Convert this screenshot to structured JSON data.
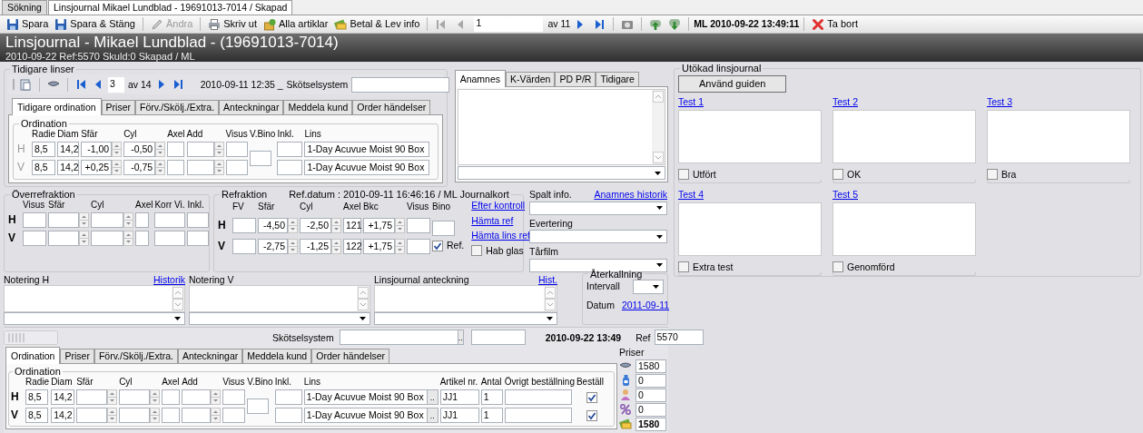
{
  "doc_tabs": [
    {
      "label": "Sökning",
      "selected": false
    },
    {
      "label": "Linsjournal Mikael Lundblad - 19691013-7014 / Skapad",
      "selected": true
    }
  ],
  "toolbar": [
    {
      "kind": "button",
      "label": "Spara",
      "disabled": false
    },
    {
      "kind": "button",
      "label": "Spara & Stäng",
      "disabled": false
    },
    {
      "kind": "separator"
    },
    {
      "kind": "button",
      "label": "Ändra",
      "disabled": true
    },
    {
      "kind": "separator"
    },
    {
      "kind": "button",
      "label": "Skriv ut",
      "disabled": false
    },
    {
      "kind": "button",
      "label": "Alla artiklar",
      "disabled": false
    },
    {
      "kind": "button",
      "label": "Betal & Lev info",
      "disabled": false
    },
    {
      "kind": "separator"
    },
    {
      "kind": "first",
      "disabled": true
    },
    {
      "kind": "prev",
      "disabled": true
    },
    {
      "kind": "page",
      "value": "1"
    },
    {
      "kind": "text",
      "label": "av 11"
    },
    {
      "kind": "next",
      "disabled": false
    },
    {
      "kind": "last",
      "disabled": false
    },
    {
      "kind": "separator"
    },
    {
      "kind": "icon",
      "disabled": false
    },
    {
      "kind": "separator"
    },
    {
      "kind": "icon",
      "disabled": false
    },
    {
      "kind": "icon",
      "disabled": false
    },
    {
      "kind": "separator"
    },
    {
      "kind": "status",
      "label": "ML 2010-09-22 13:49:11"
    },
    {
      "kind": "separator"
    },
    {
      "kind": "button",
      "label": "Ta bort",
      "disabled": false
    }
  ],
  "header": {
    "title": "Linsjournal - Mikael Lundblad - (19691013-7014)",
    "subtitle": "2010-09-22 Ref:5570 Skuld:0 Skapad / ML"
  },
  "previous_lenses": {
    "title": "Tidigare linser",
    "page": "3",
    "page_total": "av 14",
    "date": "2010-09-11 12:35 _",
    "care_system_label": "Skötselsystem",
    "tabs": [
      {
        "label": "Tidigare ordination",
        "selected": true
      },
      {
        "label": "Priser",
        "selected": false
      },
      {
        "label": "Förv./Skölj./Extra.",
        "selected": false
      },
      {
        "label": "Anteckningar",
        "selected": false
      },
      {
        "label": "Meddela kund",
        "selected": false
      },
      {
        "label": "Order händelser",
        "selected": false
      }
    ],
    "ordination": {
      "title": "Ordination",
      "readonly": true,
      "columns": [
        "Radie",
        "Diam",
        "Sfär",
        "Cyl",
        "Axel",
        "Add",
        "Visus",
        "V.Bino",
        "Inkl.",
        "Lins"
      ],
      "rows": [
        {
          "eye": "H",
          "cells": [
            {
              "kind": "text",
              "value": "8,5"
            },
            {
              "kind": "text",
              "value": "14,2"
            },
            {
              "kind": "spin",
              "value": "-1,00"
            },
            {
              "kind": "spin",
              "value": "-0,50"
            },
            {
              "kind": "text"
            },
            {
              "kind": "spin"
            },
            {
              "kind": "text"
            },
            {
              "kind": "shared"
            },
            {
              "kind": "text"
            },
            {
              "kind": "text",
              "value": "1-Day Acuvue Moist 90 Box"
            }
          ]
        },
        {
          "eye": "V",
          "cells": [
            {
              "kind": "text",
              "value": "8,5"
            },
            {
              "kind": "text",
              "value": "14,2"
            },
            {
              "kind": "spin",
              "value": "+0,25"
            },
            {
              "kind": "spin",
              "value": "-0,75"
            },
            {
              "kind": "text"
            },
            {
              "kind": "spin"
            },
            {
              "kind": "text"
            },
            {
              "kind": "shared"
            },
            {
              "kind": "text"
            },
            {
              "kind": "text",
              "value": "1-Day Acuvue Moist 90 Box"
            }
          ]
        }
      ]
    }
  },
  "anamnesis": {
    "tabs": [
      {
        "label": "Anamnes",
        "selected": true
      },
      {
        "label": "K-Värden",
        "selected": false
      },
      {
        "label": "PD P/R",
        "selected": false
      },
      {
        "label": "Tidigare",
        "selected": false
      }
    ]
  },
  "over_refraction": {
    "title": "Överrefraktion",
    "columns": [
      "Visus",
      "Sfär",
      "Cyl",
      "Axel",
      "Korr Vi.",
      "Inkl."
    ],
    "rows": [
      {
        "eye": "H",
        "cells": [
          {
            "kind": "text"
          },
          {
            "kind": "spin"
          },
          {
            "kind": "spin"
          },
          {
            "kind": "text"
          },
          {
            "kind": "text"
          },
          {
            "kind": "text"
          }
        ]
      },
      {
        "eye": "V",
        "cells": [
          {
            "kind": "text"
          },
          {
            "kind": "spin"
          },
          {
            "kind": "spin"
          },
          {
            "kind": "text"
          },
          {
            "kind": "text"
          },
          {
            "kind": "text"
          }
        ]
      }
    ]
  },
  "refraction": {
    "title": "Refraktion",
    "ref_info": "Ref.datum : 2010-09-11 16:46:16 / ML Journalkort",
    "columns": [
      "FV",
      "Sfär",
      "Cyl",
      "Axel",
      "Bkc",
      "Visus",
      "Bino"
    ],
    "rows": [
      {
        "eye": "H",
        "cells": [
          {
            "kind": "text"
          },
          {
            "kind": "spin",
            "value": "-4,50"
          },
          {
            "kind": "spin",
            "value": "-2,50"
          },
          {
            "kind": "text",
            "value": "121"
          },
          {
            "kind": "spin",
            "value": "+1,75"
          },
          {
            "kind": "text"
          },
          {
            "kind": "shared"
          }
        ]
      },
      {
        "eye": "V",
        "cells": [
          {
            "kind": "text"
          },
          {
            "kind": "spin",
            "value": "-2,75"
          },
          {
            "kind": "spin",
            "value": "-1,25"
          },
          {
            "kind": "text",
            "value": "122"
          },
          {
            "kind": "spin",
            "value": "+1,75"
          },
          {
            "kind": "text"
          },
          {
            "kind": "shared"
          }
        ]
      }
    ],
    "ref": {
      "label": "Ref.",
      "checked": true
    },
    "links": [
      "Efter kontroll",
      "Hämta ref",
      "Hämta lins ref"
    ],
    "hab_glas": {
      "label": "Hab glas",
      "checked": false
    }
  },
  "slit": [
    {
      "label": "Spalt info.",
      "link": "Anamnes historik"
    },
    {
      "label": "Evertering"
    },
    {
      "label": "Tårfilm"
    }
  ],
  "notes": [
    {
      "label": "Notering H",
      "link": "Historik"
    },
    {
      "label": "Notering V"
    },
    {
      "label": "Linsjournal anteckning",
      "link": "Hist."
    }
  ],
  "recall": {
    "title": "Återkallning",
    "interval_label": "Intervall",
    "date_label": "Datum",
    "date": "2011-09-11"
  },
  "order": {
    "care_system_label": "Skötselsystem",
    "browse": "..",
    "date": "2010-09-22 13:49",
    "ref_label": "Ref",
    "ref": "5570",
    "tabs": [
      {
        "label": "Ordination",
        "selected": true
      },
      {
        "label": "Priser",
        "selected": false
      },
      {
        "label": "Förv./Skölj./Extra.",
        "selected": false
      },
      {
        "label": "Anteckningar",
        "selected": false
      },
      {
        "label": "Meddela kund",
        "selected": false
      },
      {
        "label": "Order händelser",
        "selected": false
      }
    ],
    "ordination": {
      "title": "Ordination",
      "readonly": false,
      "columns": [
        "Radie",
        "Diam",
        "Sfär",
        "Cyl",
        "Axel",
        "Add",
        "Visus",
        "V.Bino",
        "Inkl.",
        "Lins",
        "Artikel nr.",
        "Antal",
        "Övrigt beställning",
        "Beställ"
      ],
      "rows": [
        {
          "eye": "H",
          "cells": [
            {
              "kind": "text",
              "value": "8,5"
            },
            {
              "kind": "text",
              "value": "14,2"
            },
            {
              "kind": "spin"
            },
            {
              "kind": "spin"
            },
            {
              "kind": "text"
            },
            {
              "kind": "spin"
            },
            {
              "kind": "text"
            },
            {
              "kind": "shared"
            },
            {
              "kind": "text"
            },
            {
              "kind": "lookup",
              "value": "1-Day Acuvue Moist 90 Box",
              "browse": ".."
            },
            {
              "kind": "text",
              "value": "JJ1"
            },
            {
              "kind": "text",
              "value": "1"
            },
            {
              "kind": "text"
            },
            {
              "kind": "check",
              "checked": true
            }
          ]
        },
        {
          "eye": "V",
          "cells": [
            {
              "kind": "text",
              "value": "8,5"
            },
            {
              "kind": "text",
              "value": "14,2"
            },
            {
              "kind": "spin"
            },
            {
              "kind": "spin"
            },
            {
              "kind": "text"
            },
            {
              "kind": "spin"
            },
            {
              "kind": "text"
            },
            {
              "kind": "shared"
            },
            {
              "kind": "text"
            },
            {
              "kind": "lookup",
              "value": "1-Day Acuvue Moist 90 Box",
              "browse": ".."
            },
            {
              "kind": "text",
              "value": "JJ1"
            },
            {
              "kind": "text",
              "value": "1"
            },
            {
              "kind": "text"
            },
            {
              "kind": "check",
              "checked": true
            }
          ]
        }
      ]
    },
    "prices": {
      "title": "Priser",
      "items": [
        {
          "value": "1580",
          "kind": "item"
        },
        {
          "value": "0",
          "kind": "item"
        },
        {
          "value": "0",
          "kind": "item"
        },
        {
          "value": "0",
          "kind": "item"
        },
        {
          "value": "1580",
          "kind": "total"
        }
      ]
    }
  },
  "extended": {
    "title": "Utökad linsjournal",
    "button": "Använd guiden",
    "tests": [
      {
        "link": "Test 1",
        "check_label": "Utfört",
        "checked": false
      },
      {
        "link": "Test 2",
        "check_label": "OK",
        "checked": false
      },
      {
        "link": "Test 3",
        "check_label": "Bra",
        "checked": false
      },
      {
        "link": "Test 4",
        "check_label": "Extra test",
        "checked": false
      },
      {
        "link": "Test 5",
        "check_label": "Genomförd",
        "checked": false
      }
    ]
  }
}
